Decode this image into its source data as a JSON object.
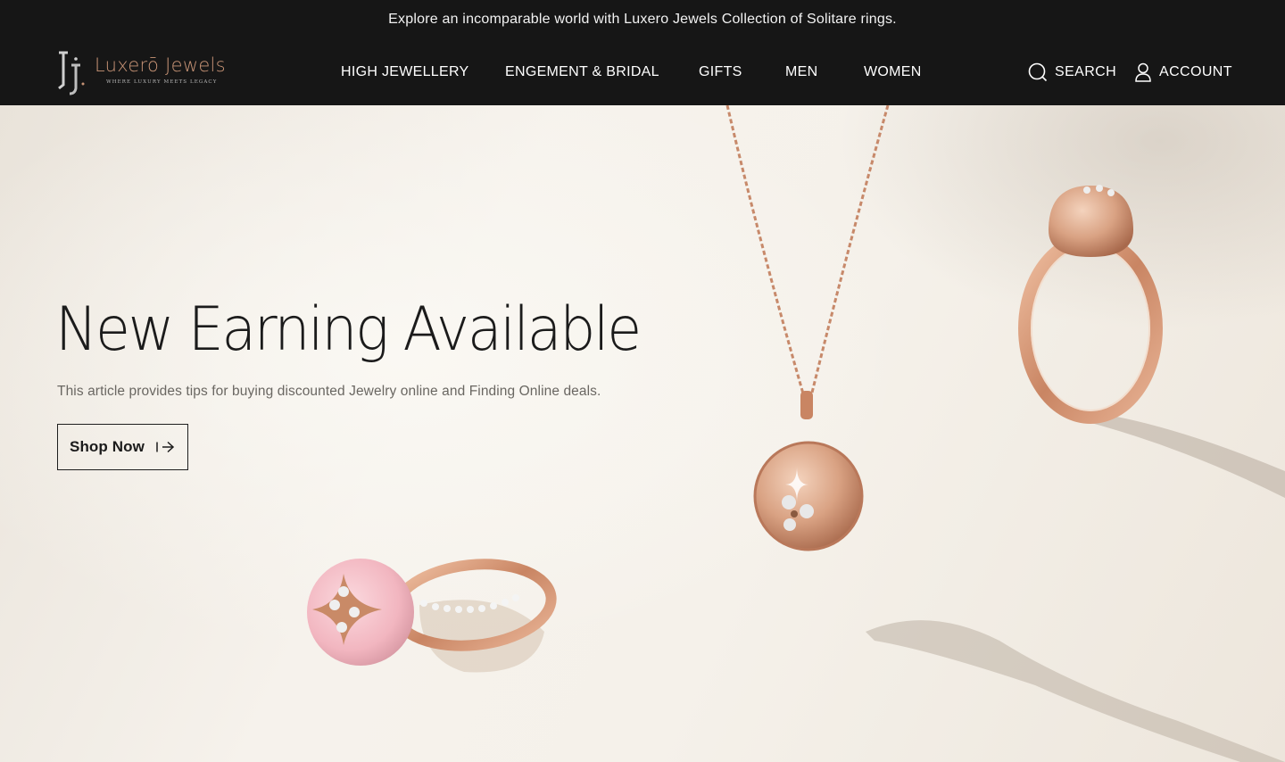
{
  "announcement": "Explore an incomparable world with Luxero Jewels Collection of Solitare rings.",
  "brand": {
    "name": "Luxerō Jewels",
    "tagline": "WHERE LUXURY MEETS LEGACY",
    "accent_color": "#c89476"
  },
  "nav": {
    "items": [
      {
        "label": "HIGH JEWELLERY"
      },
      {
        "label": "ENGEMENT & BRIDAL"
      },
      {
        "label": "GIFTS"
      },
      {
        "label": "MEN"
      },
      {
        "label": "WOMEN"
      }
    ]
  },
  "utilities": {
    "search_label": "SEARCH",
    "search_icon": "search-icon",
    "account_label": "ACCOUNT",
    "account_icon": "user-icon"
  },
  "hero": {
    "title": "New Earning Available",
    "subtitle": "This article provides tips for buying discounted Jewelry online and Finding Online deals.",
    "cta_label": "Shop Now",
    "cta_icon": "arrow-right-icon"
  },
  "colors": {
    "header_bg": "#161616",
    "hero_bg": "#f5f1eb",
    "rose_gold": "#d6a07f",
    "pink_stone": "#f2b9c2"
  }
}
